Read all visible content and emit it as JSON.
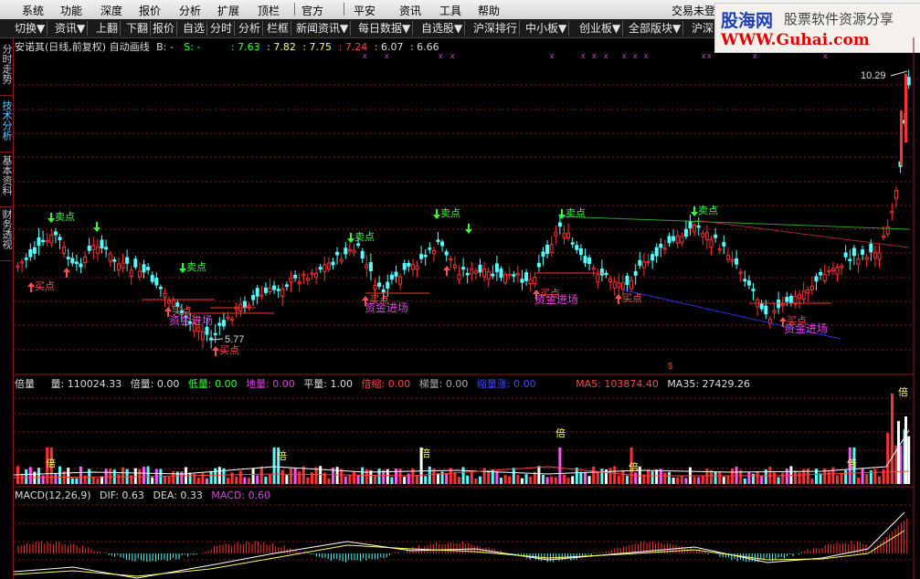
{
  "menu": {
    "items": [
      "系统",
      "功能",
      "深度",
      "报价",
      "分析",
      "扩展",
      "顶栏",
      "官方",
      "平安",
      "资讯",
      "工具",
      "帮助"
    ],
    "trade": "交易未登"
  },
  "toolbar": {
    "items": [
      "切换▼",
      "资讯▼",
      "上翻",
      "下翻",
      "报价",
      "自选",
      "分时",
      "分析",
      "栏框",
      "新闻资讯▼",
      "每日数据▼",
      "自选股▼",
      "沪深排行",
      "中小板▼",
      "创业板▼",
      "全部版块▼",
      "沪深"
    ]
  },
  "logo": {
    "big": "股海网",
    "slogan": "股票软件资源分享",
    "url": "WWW.Guhai.com"
  },
  "side_tabs": [
    {
      "label": "分时走势",
      "active": false
    },
    {
      "label": "技术分析",
      "active": true
    },
    {
      "label": "基本资料",
      "active": false
    },
    {
      "label": "财务透视",
      "active": false
    }
  ],
  "price_info": {
    "title": "安诺其(日线,前复权) 自动画线",
    "b_label": "B: -",
    "s_label": "S: -",
    "v1": ": 7.63",
    "v2": ": 7.82",
    "v3": ": 7.75",
    "v4": ": 7.24",
    "v5": ": 6.07",
    "v6": ": 6.66"
  },
  "price_labels": {
    "high": "10.29",
    "low": "5.77",
    "sell": "卖点",
    "buy": "买点",
    "fund": "资金进场",
    "bottom_marker": "$"
  },
  "volume_info": {
    "title": "倍量",
    "vol": "量: 110024.33",
    "bei": "倍量: 0.00",
    "di": "低量: 0.00",
    "de": "地量: 0.00",
    "ping": "平量: 1.00",
    "beisuo": "倍缩: 0.00",
    "ti": "梯量: 0.00",
    "suoliang": "缩量涨: 0.00",
    "ma5": "MA5: 103874.40",
    "ma35": "MA35: 27429.26",
    "bei_mark": "倍"
  },
  "macd_info": {
    "title": "MACD(12,26,9)",
    "dif": "DIF: 0.63",
    "dea": "DEA: 0.33",
    "macd": "MACD: 0.60"
  },
  "chart_data": {
    "type": "candlestick",
    "ohlc_note": "daily candles, front-adjusted",
    "price_high": 10.29,
    "price_low": 5.77,
    "volume_last": 110024.33,
    "volume_ma5": 103874.4,
    "volume_ma35": 27429.26,
    "macd": {
      "dif": 0.63,
      "dea": 0.33,
      "macd": 0.6
    }
  },
  "colors": {
    "up": "#ff3030",
    "down": "#54ffff",
    "grid": "#8a1a1a",
    "sell": "#33ff33",
    "buy": "#ff5050",
    "fund": "#e040e0",
    "ma_white": "#ffffff",
    "ma_yellow": "#ffff55"
  }
}
